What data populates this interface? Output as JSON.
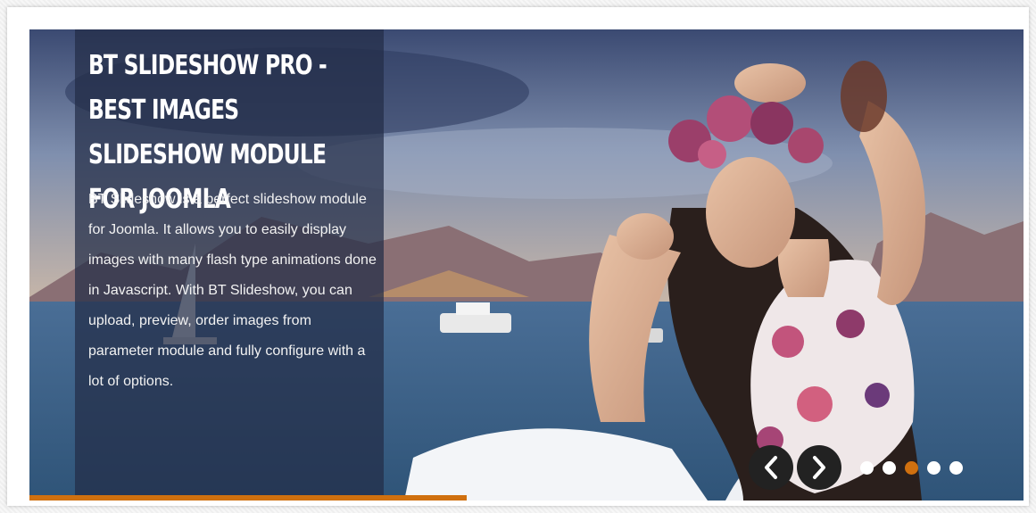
{
  "slideshow": {
    "caption": {
      "title": "BT SLIDESHOW PRO - BEST IMAGES SLIDESHOW MODULE FOR JOOMLA",
      "body": "BT Slideshow is a perfect slideshow module for Joomla. It allows you to easily display images with many flash type animations done in Javascript. With BT Slideshow, you can upload, preview, order images from parameter module and fully configure with a lot of options."
    },
    "progress": 0.44,
    "slide_count": 5,
    "active_index": 2,
    "colors": {
      "accent": "#d0700f",
      "panel": "#232d46",
      "nav_button": "#222222"
    },
    "icons": {
      "prev": "chevron-left-icon",
      "next": "chevron-right-icon"
    }
  }
}
